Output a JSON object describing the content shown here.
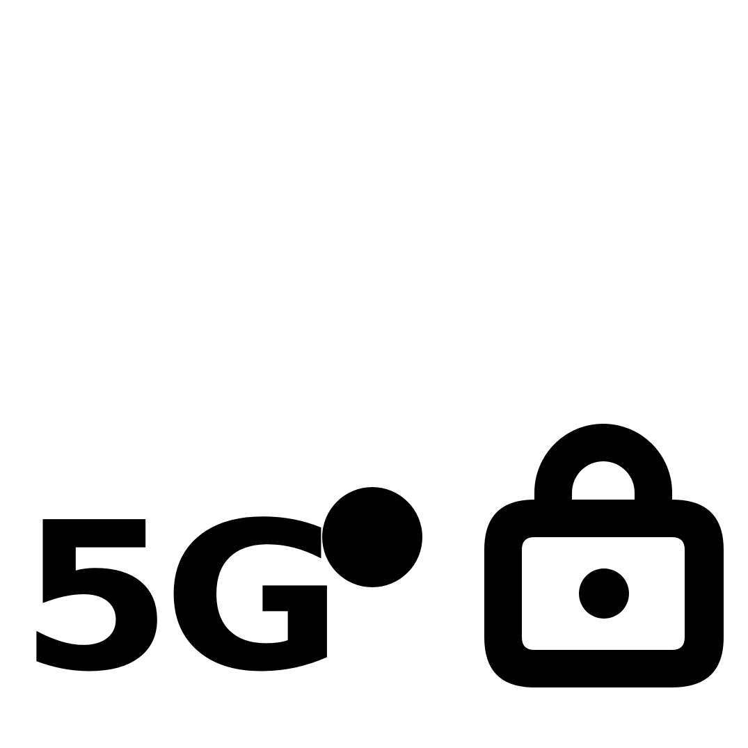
{
  "status_icon": {
    "network_type": "5G",
    "separator_icon": "dot-icon",
    "lock_icon": "lock-icon",
    "color": "#000000",
    "background": "#ffffff"
  }
}
